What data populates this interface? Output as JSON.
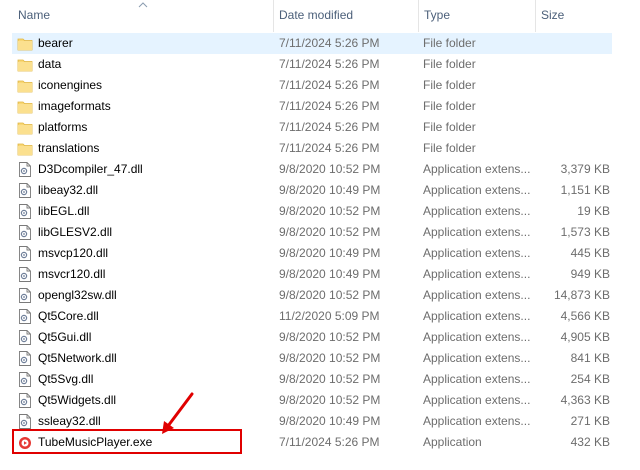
{
  "columns": {
    "name": "Name",
    "date": "Date modified",
    "type": "Type",
    "size": "Size"
  },
  "files": [
    {
      "name": "bearer",
      "date": "7/11/2024 5:26 PM",
      "type": "File folder",
      "size": "",
      "icon": "folder-icon",
      "selected": true
    },
    {
      "name": "data",
      "date": "7/11/2024 5:26 PM",
      "type": "File folder",
      "size": "",
      "icon": "folder-icon"
    },
    {
      "name": "iconengines",
      "date": "7/11/2024 5:26 PM",
      "type": "File folder",
      "size": "",
      "icon": "folder-icon"
    },
    {
      "name": "imageformats",
      "date": "7/11/2024 5:26 PM",
      "type": "File folder",
      "size": "",
      "icon": "folder-icon"
    },
    {
      "name": "platforms",
      "date": "7/11/2024 5:26 PM",
      "type": "File folder",
      "size": "",
      "icon": "folder-icon"
    },
    {
      "name": "translations",
      "date": "7/11/2024 5:26 PM",
      "type": "File folder",
      "size": "",
      "icon": "folder-icon"
    },
    {
      "name": "D3Dcompiler_47.dll",
      "date": "9/8/2020 10:52 PM",
      "type": "Application extens...",
      "size": "3,379 KB",
      "icon": "dll-file-icon"
    },
    {
      "name": "libeay32.dll",
      "date": "9/8/2020 10:49 PM",
      "type": "Application extens...",
      "size": "1,151 KB",
      "icon": "dll-file-icon"
    },
    {
      "name": "libEGL.dll",
      "date": "9/8/2020 10:52 PM",
      "type": "Application extens...",
      "size": "19 KB",
      "icon": "dll-file-icon"
    },
    {
      "name": "libGLESV2.dll",
      "date": "9/8/2020 10:52 PM",
      "type": "Application extens...",
      "size": "1,573 KB",
      "icon": "dll-file-icon"
    },
    {
      "name": "msvcp120.dll",
      "date": "9/8/2020 10:49 PM",
      "type": "Application extens...",
      "size": "445 KB",
      "icon": "dll-file-icon"
    },
    {
      "name": "msvcr120.dll",
      "date": "9/8/2020 10:49 PM",
      "type": "Application extens...",
      "size": "949 KB",
      "icon": "dll-file-icon"
    },
    {
      "name": "opengl32sw.dll",
      "date": "9/8/2020 10:52 PM",
      "type": "Application extens...",
      "size": "14,873 KB",
      "icon": "dll-file-icon"
    },
    {
      "name": "Qt5Core.dll",
      "date": "11/2/2020 5:09 PM",
      "type": "Application extens...",
      "size": "4,566 KB",
      "icon": "dll-file-icon"
    },
    {
      "name": "Qt5Gui.dll",
      "date": "9/8/2020 10:52 PM",
      "type": "Application extens...",
      "size": "4,905 KB",
      "icon": "dll-file-icon"
    },
    {
      "name": "Qt5Network.dll",
      "date": "9/8/2020 10:52 PM",
      "type": "Application extens...",
      "size": "841 KB",
      "icon": "dll-file-icon"
    },
    {
      "name": "Qt5Svg.dll",
      "date": "9/8/2020 10:52 PM",
      "type": "Application extens...",
      "size": "254 KB",
      "icon": "dll-file-icon"
    },
    {
      "name": "Qt5Widgets.dll",
      "date": "9/8/2020 10:52 PM",
      "type": "Application extens...",
      "size": "4,363 KB",
      "icon": "dll-file-icon"
    },
    {
      "name": "ssleay32.dll",
      "date": "9/8/2020 10:49 PM",
      "type": "Application extens...",
      "size": "271 KB",
      "icon": "dll-file-icon"
    },
    {
      "name": "TubeMusicPlayer.exe",
      "date": "7/11/2024 5:26 PM",
      "type": "Application",
      "size": "432 KB",
      "icon": "tubemusicplayer-app-icon"
    }
  ],
  "colors": {
    "selection": "#e5f3ff",
    "folder": "#f8d775",
    "annotation": "#e00000"
  }
}
